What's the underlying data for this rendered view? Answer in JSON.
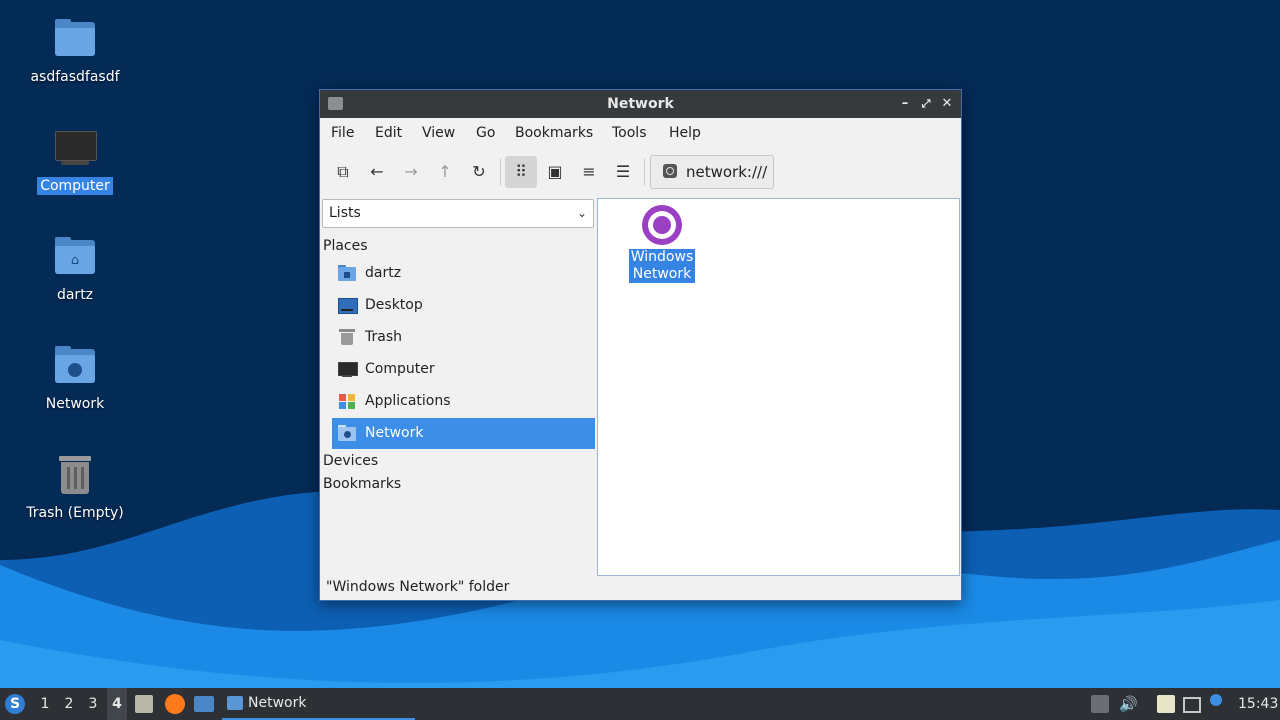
{
  "colors": {
    "accent": "#3584e4",
    "titlebar": "#373a3d",
    "taskbar": "#2d3034",
    "desktop_dark": "#042a56",
    "wave_light": "#1a8ae6"
  },
  "desktop": {
    "icons": [
      {
        "label": "asdfasdfasdf",
        "icon": "folder-icon"
      },
      {
        "label": "Computer",
        "icon": "computer-icon",
        "selected": true
      },
      {
        "label": "dartz",
        "icon": "home-folder-icon"
      },
      {
        "label": "Network",
        "icon": "network-folder-icon"
      },
      {
        "label": "Trash (Empty)",
        "icon": "trash-icon"
      }
    ]
  },
  "window": {
    "title": "Network",
    "controls": {
      "minimize": "–",
      "maximize": "⤢",
      "close": "✕"
    },
    "menu": [
      "File",
      "Edit",
      "View",
      "Go",
      "Bookmarks",
      "Tools",
      "Help"
    ],
    "toolbar": {
      "new_window": "⧉",
      "back": "←",
      "forward": "→",
      "up": "↑",
      "reload": "↻",
      "icon_view": "⠿",
      "compact_view": "▣",
      "list_view": "≡",
      "detail_view": "☰"
    },
    "location": "network:///",
    "sidebar": {
      "selector": "Lists",
      "places_header": "Places",
      "places": [
        {
          "label": "dartz",
          "icon": "home-folder-icon"
        },
        {
          "label": "Desktop",
          "icon": "desktop-icon"
        },
        {
          "label": "Trash",
          "icon": "trash-icon"
        },
        {
          "label": "Computer",
          "icon": "computer-icon"
        },
        {
          "label": "Applications",
          "icon": "applications-icon"
        },
        {
          "label": "Network",
          "icon": "network-icon",
          "selected": true
        }
      ],
      "devices_header": "Devices",
      "bookmarks_header": "Bookmarks"
    },
    "content": {
      "items": [
        {
          "line1": "Windows",
          "line2": "Network",
          "icon": "windows-network-icon"
        }
      ]
    },
    "status": "\"Windows Network\" folder"
  },
  "taskbar": {
    "workspaces": [
      "1",
      "2",
      "3",
      "4"
    ],
    "active_workspace": "4",
    "task_label": "Network",
    "clock": "15:43"
  }
}
